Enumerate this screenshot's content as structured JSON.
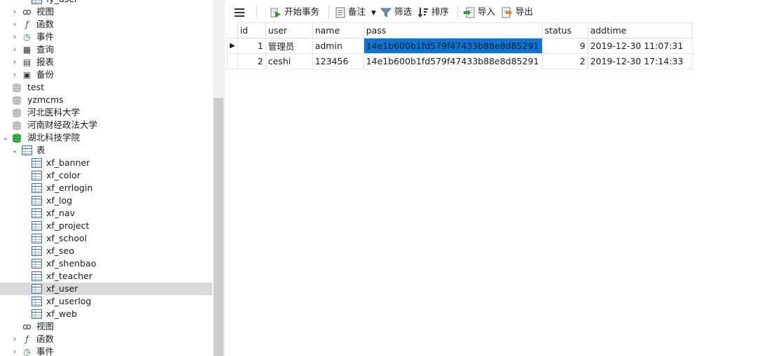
{
  "nav": {
    "items": [
      {
        "label": "fy_user",
        "icon": "table-icon",
        "indent": 3,
        "expander": ""
      },
      {
        "label": "视图",
        "icon": "view-icon",
        "indent": 2,
        "expander": "›"
      },
      {
        "label": "函数",
        "icon": "function-icon",
        "indent": 2,
        "expander": "›"
      },
      {
        "label": "事件",
        "icon": "event-icon",
        "indent": 2,
        "expander": "›"
      },
      {
        "label": "查询",
        "icon": "query-icon",
        "indent": 2,
        "expander": "›"
      },
      {
        "label": "报表",
        "icon": "report-icon",
        "indent": 2,
        "expander": "›"
      },
      {
        "label": "备份",
        "icon": "backup-icon",
        "indent": 2,
        "expander": "›"
      },
      {
        "label": "test",
        "icon": "database-icon",
        "indent": 1,
        "expander": ""
      },
      {
        "label": "yzmcms",
        "icon": "database-icon",
        "indent": 1,
        "expander": ""
      },
      {
        "label": "河北医科大学",
        "icon": "database-icon",
        "indent": 1,
        "expander": ""
      },
      {
        "label": "河南财经政法大学",
        "icon": "database-icon",
        "indent": 1,
        "expander": ""
      },
      {
        "label": "湖北科技学院",
        "icon": "database-open-icon",
        "indent": 1,
        "expander": "⌄"
      },
      {
        "label": "表",
        "icon": "tables-icon",
        "indent": 2,
        "expander": "⌄"
      },
      {
        "label": "xf_banner",
        "icon": "table-icon",
        "indent": 3,
        "expander": ""
      },
      {
        "label": "xf_color",
        "icon": "table-icon",
        "indent": 3,
        "expander": ""
      },
      {
        "label": "xf_errlogin",
        "icon": "table-icon",
        "indent": 3,
        "expander": ""
      },
      {
        "label": "xf_log",
        "icon": "table-icon",
        "indent": 3,
        "expander": ""
      },
      {
        "label": "xf_nav",
        "icon": "table-icon",
        "indent": 3,
        "expander": ""
      },
      {
        "label": "xf_project",
        "icon": "table-icon",
        "indent": 3,
        "expander": ""
      },
      {
        "label": "xf_school",
        "icon": "table-icon",
        "indent": 3,
        "expander": ""
      },
      {
        "label": "xf_seo",
        "icon": "table-icon",
        "indent": 3,
        "expander": ""
      },
      {
        "label": "xf_shenbao",
        "icon": "table-icon",
        "indent": 3,
        "expander": ""
      },
      {
        "label": "xf_teacher",
        "icon": "table-icon",
        "indent": 3,
        "expander": ""
      },
      {
        "label": "xf_user",
        "icon": "table-icon",
        "indent": 3,
        "expander": "",
        "selected": true
      },
      {
        "label": "xf_userlog",
        "icon": "table-icon",
        "indent": 3,
        "expander": ""
      },
      {
        "label": "xf_web",
        "icon": "table-icon",
        "indent": 3,
        "expander": ""
      },
      {
        "label": "视图",
        "icon": "view-icon",
        "indent": 2,
        "expander": ""
      },
      {
        "label": "函数",
        "icon": "function-icon",
        "indent": 2,
        "expander": "›"
      },
      {
        "label": "事件",
        "icon": "event-icon",
        "indent": 2,
        "expander": "›"
      }
    ]
  },
  "toolbar": {
    "menu_icon": "hamburger-menu-icon",
    "begin_transaction": "开始事务",
    "memo": "备注",
    "filter": "筛选",
    "sort": "排序",
    "import": "导入",
    "export": "导出"
  },
  "grid": {
    "columns": [
      "id",
      "user",
      "name",
      "pass",
      "status",
      "addtime"
    ],
    "rows": [
      {
        "id": "1",
        "user": "管理员",
        "name": "admin",
        "pass": "14e1b600b1fd579f47433b88e8d85291",
        "status": "9",
        "addtime": "2019-12-30 11:07:31",
        "current": true
      },
      {
        "id": "2",
        "user": "ceshi",
        "name": "123456",
        "pass": "14e1b600b1fd579f47433b88e8d85291",
        "status": "2",
        "addtime": "2019-12-30 17:14:33",
        "current": false
      }
    ],
    "current_row_marker": "▶",
    "selected_cell": "pass",
    "selection_color": "#0a74d8"
  }
}
